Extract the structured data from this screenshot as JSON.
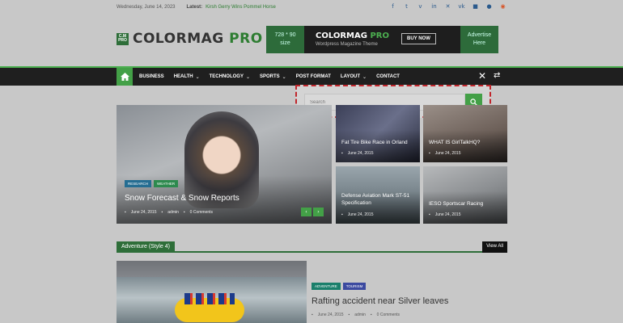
{
  "top_bar": {
    "date": "Wednesday, June 14, 2023",
    "latest_label": "Latest:",
    "latest_link": "Kirsh Gerry Wins Pommel Horse",
    "social_icons": [
      "facebook-icon",
      "twitter-icon",
      "vimeo-icon",
      "linkedin-icon",
      "xing-icon",
      "vk-icon",
      "foursquare-icon",
      "flickr-icon",
      "rss-icon"
    ]
  },
  "logo": {
    "badge_top": "C.M",
    "badge_bottom": "PRO",
    "text_primary": "COLORMAG",
    "text_accent": " PRO"
  },
  "ad": {
    "size_line1": "728 * 90",
    "size_line2": "size",
    "title_primary": "COLORMAG",
    "title_accent": " PRO",
    "subtitle": "Wordpress Magazine Theme",
    "button": "BUY NOW",
    "right_line1": "Advertise",
    "right_line2": "Here"
  },
  "nav": {
    "items": [
      {
        "label": "BUSINESS",
        "caret": false
      },
      {
        "label": "HEALTH",
        "caret": true
      },
      {
        "label": "TECHNOLOGY",
        "caret": true
      },
      {
        "label": "SPORTS",
        "caret": true
      },
      {
        "label": "POST FORMAT",
        "caret": false
      },
      {
        "label": "LAYOUT",
        "caret": true
      },
      {
        "label": "CONTACT",
        "caret": false
      }
    ],
    "close_glyph": "✕",
    "shuffle_glyph": "⇄"
  },
  "search": {
    "placeholder": "Search"
  },
  "featured": {
    "tags": [
      "RESEARCH",
      "WEATHER"
    ],
    "title": "Snow Forecast & Snow Reports",
    "date": "June 24, 2015",
    "author": "admin",
    "comments": "0 Comments",
    "prev": "‹",
    "next": "›"
  },
  "tiles": [
    {
      "title": "Fat Tire Bike Race in Orland",
      "date": "June 24, 2015"
    },
    {
      "title": "WHAT IS GirlTalkHQ?",
      "date": "June 24, 2015"
    },
    {
      "title": "Defense Aviation Mark ST-51 Specification",
      "date": "June 24, 2015"
    },
    {
      "title": "IESO Sportscar Racing",
      "date": "June 24, 2015"
    }
  ],
  "section": {
    "title": "Adventure (Style 4)",
    "view_all": "View All"
  },
  "adventure": {
    "tags": [
      "ADVENTURE",
      "TOURISM"
    ],
    "title": "Rafting accident near Silver leaves",
    "date": "June 24, 2015",
    "author": "admin",
    "comments": "0 Comments"
  }
}
